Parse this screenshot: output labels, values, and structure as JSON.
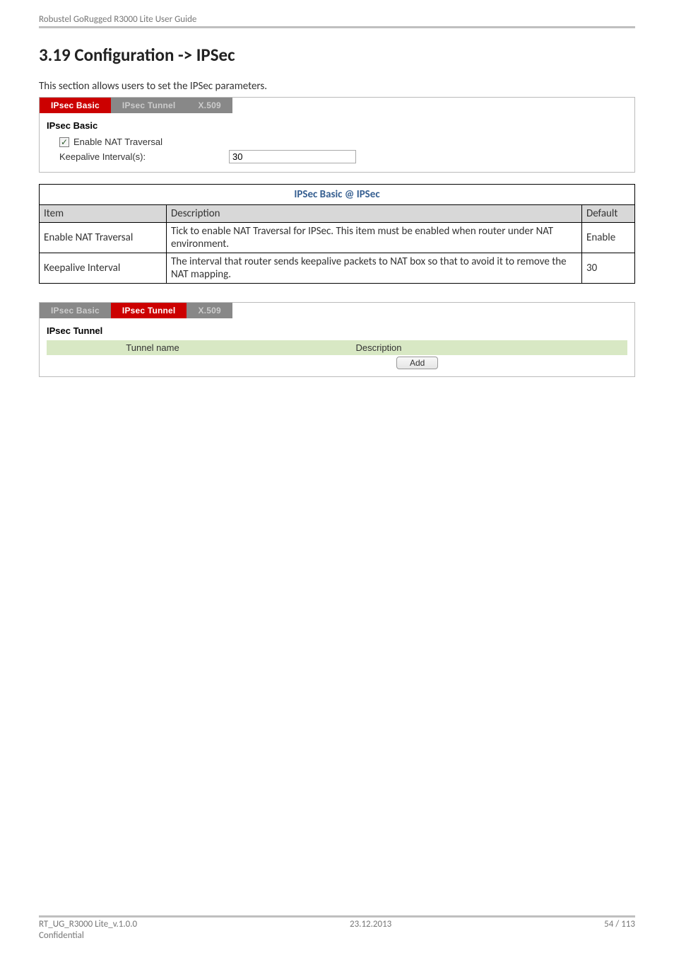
{
  "header": {
    "guide": "Robustel GoRugged R3000 Lite User Guide"
  },
  "section": {
    "title": "3.19  Configuration -> IPSec",
    "intro": "This section allows users to set the IPSec parameters."
  },
  "panel1": {
    "tabs": {
      "basic": "IPsec Basic",
      "tunnel": "IPsec Tunnel",
      "x509": "X.509"
    },
    "group_label": "IPsec Basic",
    "nat_label": "Enable NAT Traversal",
    "nat_checked": true,
    "interval_label": "Keepalive Interval(s):",
    "interval_value": "30"
  },
  "param_table": {
    "caption": "IPSec Basic @ IPSec",
    "head": {
      "item": "Item",
      "desc": "Description",
      "def": "Default"
    },
    "rows": [
      {
        "item": "Enable NAT Traversal",
        "desc": "Tick to enable NAT Traversal for IPSec. This item must be enabled when router under NAT environment.",
        "def": "Enable"
      },
      {
        "item": "Keepalive Interval",
        "desc": "The interval that router sends keepalive packets to NAT box so that to avoid it to remove the NAT mapping.",
        "def": "30"
      }
    ]
  },
  "panel2": {
    "tabs": {
      "basic": "IPsec Basic",
      "tunnel": "IPsec Tunnel",
      "x509": "X.509"
    },
    "group_label": "IPsec Tunnel",
    "list_head": {
      "name": "Tunnel name",
      "desc": "Description"
    },
    "add_label": "Add"
  },
  "footer": {
    "left1": "RT_UG_R3000 Lite_v.1.0.0",
    "left2": "Confidential",
    "mid": "23.12.2013",
    "right": "54 / 113"
  }
}
